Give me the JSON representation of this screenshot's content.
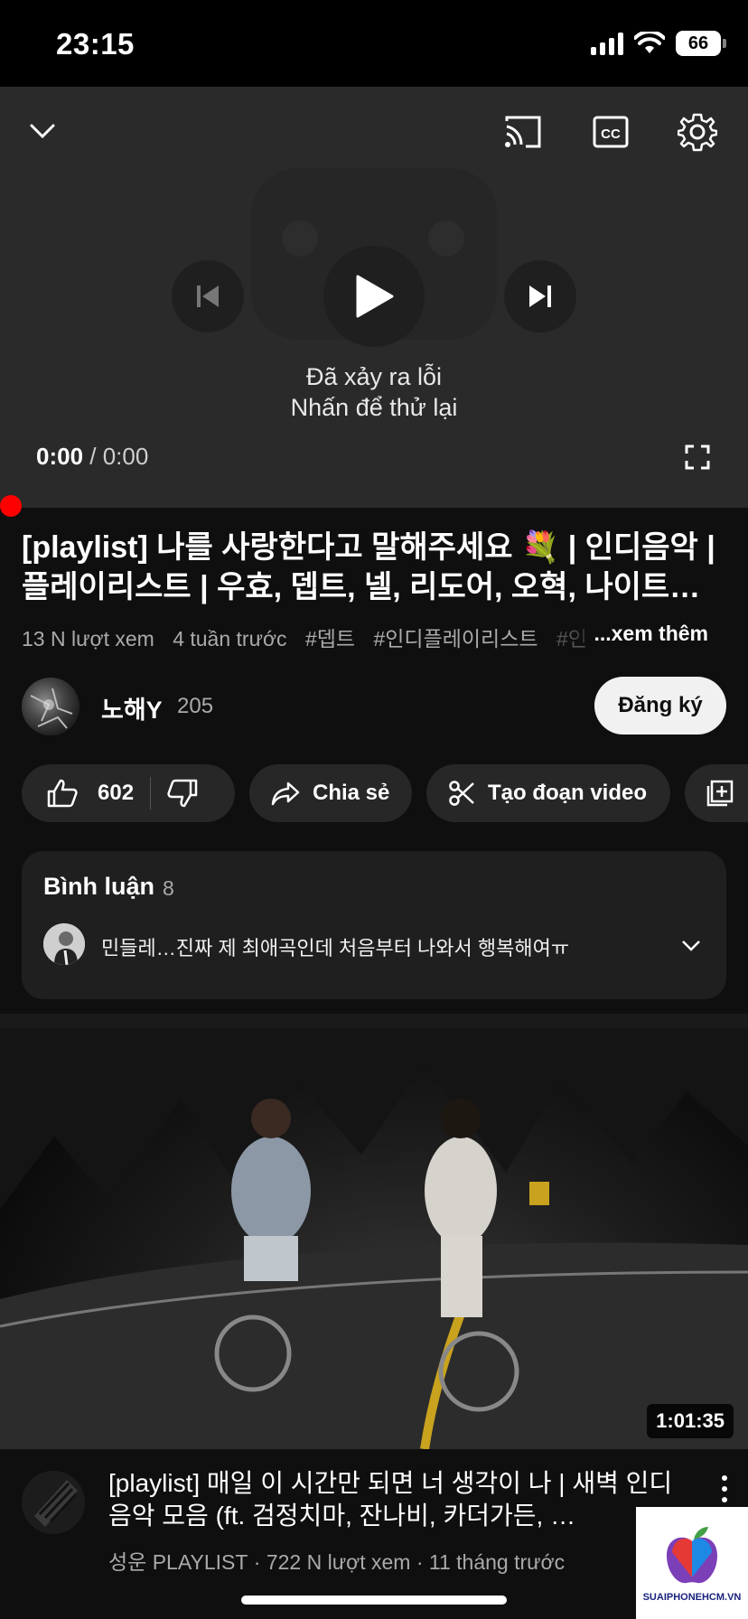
{
  "status_bar": {
    "time": "23:15",
    "battery": "66"
  },
  "player": {
    "error_line1": "Đã xảy ra lỗi",
    "error_line2": "Nhấn để thử lại",
    "current_time": "0:00",
    "separator": " / ",
    "duration": "0:00",
    "progress": 0
  },
  "video": {
    "title": "[playlist] 나를 사랑한다고 말해주세요 💐 | 인디음악 | 플레이리스트 | 우효, 뎁트, 넬,  리도어, 오혁, 나이트…",
    "views": "13 N lượt xem",
    "age": "4 tuần trước",
    "tags": [
      "#뎁트",
      "#인디플레이리스트"
    ],
    "tag_fade": "#인",
    "more": "...xem thêm"
  },
  "channel": {
    "name": "노해Y",
    "subscribers": "205",
    "subscribe_label": "Đăng ký"
  },
  "actions": {
    "likes": "602",
    "share": "Chia sẻ",
    "clip": "Tạo đoạn video"
  },
  "comments": {
    "title": "Bình luận",
    "count": "8",
    "top_comment": "민들레…진짜 제 최애곡인데 처음부터 나와서 행복해여ㅠ"
  },
  "recommendation": {
    "duration": "1:01:35",
    "title": "[playlist] 매일 이 시간만 되면 너 생각이 나 |  새벽 인디 음악 모음 (ft. 검정치마, 잔나비, 카더가든, …",
    "channel": "성운 PLAYLIST",
    "views": "722 N lượt xem",
    "age": "11 tháng trước",
    "dot": " · "
  },
  "watermark": {
    "text": "SUAIPHONEHCM.VN"
  },
  "icons": {
    "collapse": "chevron-down-icon",
    "cast": "cast-icon",
    "captions": "cc-icon",
    "settings": "gear-icon",
    "previous": "skip-previous-icon",
    "play": "play-icon",
    "next": "skip-next-icon",
    "fullscreen": "fullscreen-icon",
    "like": "thumb-up-icon",
    "dislike": "thumb-down-icon",
    "share": "share-icon",
    "clip": "scissors-icon",
    "save": "playlist-add-icon",
    "expand": "chevron-down-icon",
    "more": "more-vert-icon"
  },
  "colors": {
    "accent_red": "#ff0000",
    "background": "#0f0f0f",
    "pill": "#272727"
  }
}
